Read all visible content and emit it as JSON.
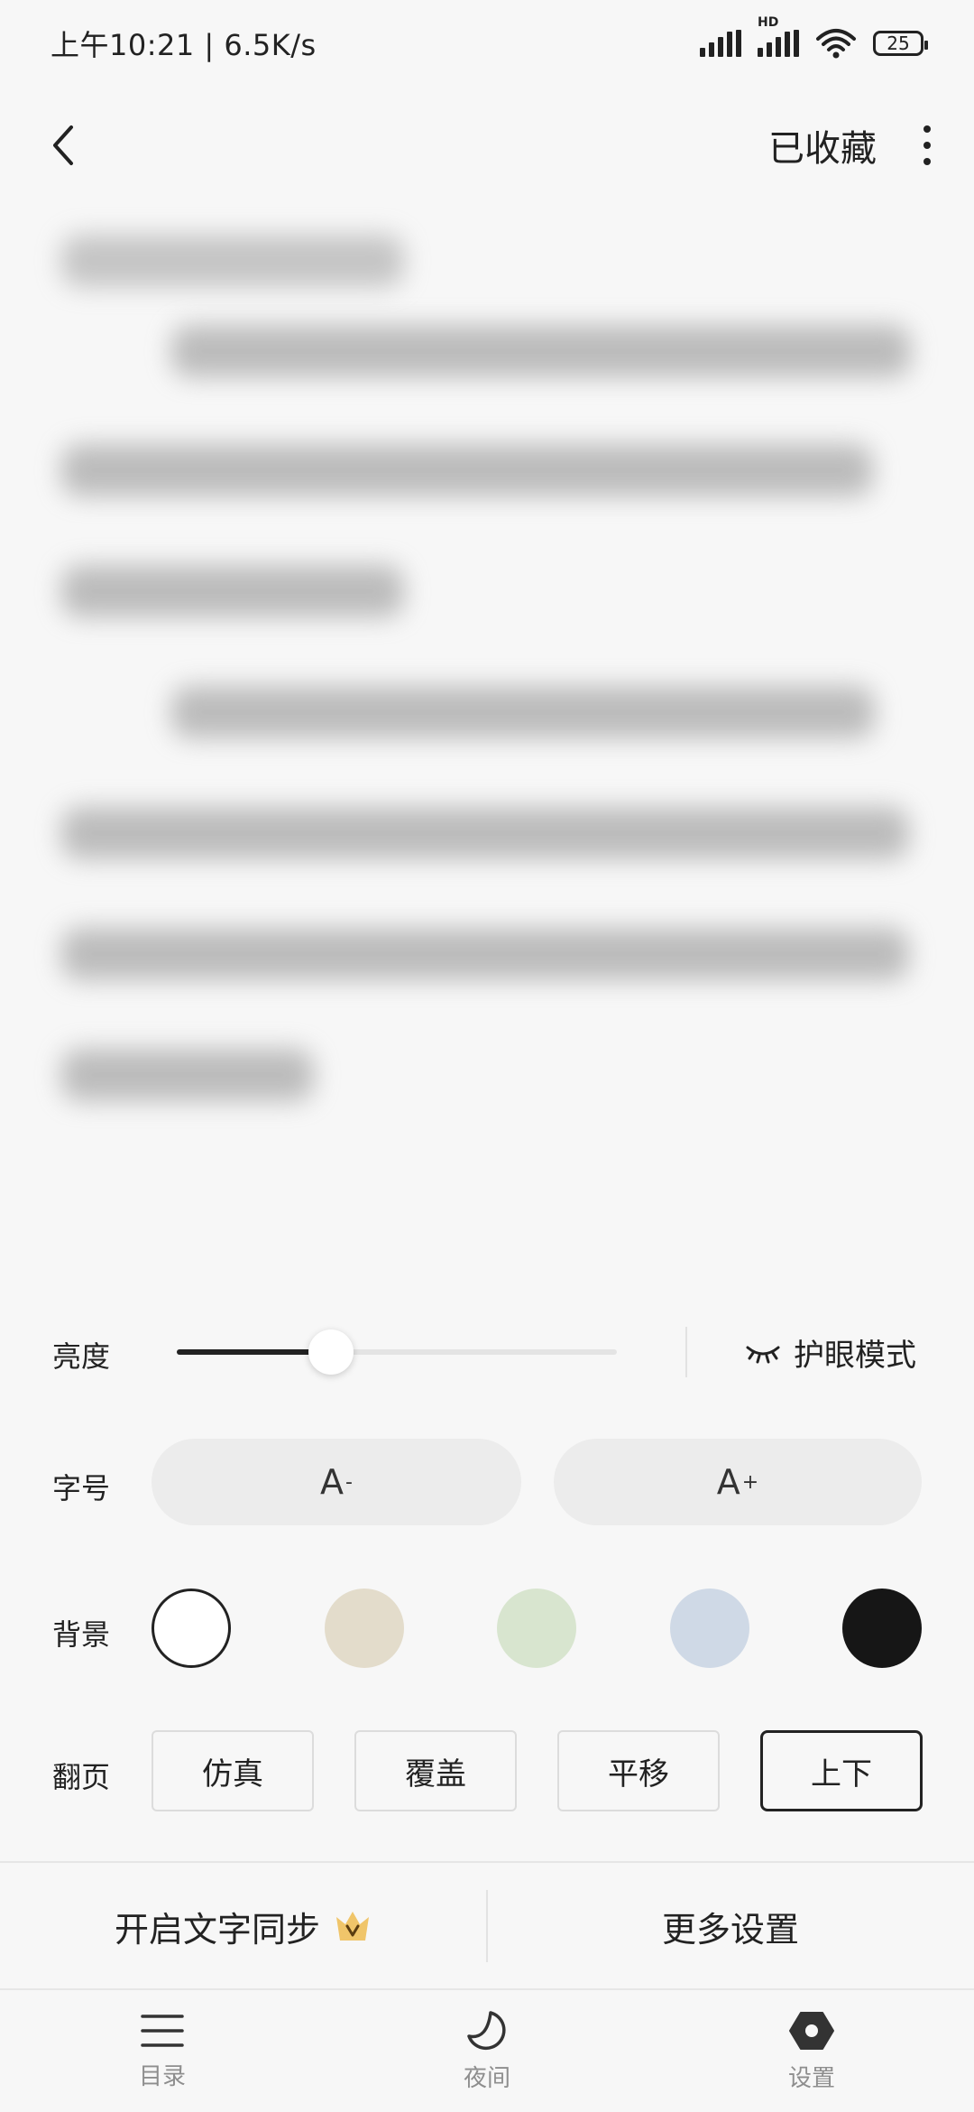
{
  "status_bar": {
    "time_speed": "上午10:21 | 6.5K/s",
    "hd_label": "HD",
    "battery": "25"
  },
  "top_bar": {
    "collected_label": "已收藏"
  },
  "settings": {
    "brightness": {
      "label": "亮度",
      "value_fraction": 0.35
    },
    "eye_mode_label": "护眼模式",
    "font_size": {
      "label": "字号",
      "decrease_label": "A",
      "decrease_sup": "-",
      "increase_label": "A",
      "increase_sup": "+"
    },
    "background": {
      "label": "背景",
      "colors": [
        "#ffffff",
        "#e3dccb",
        "#d8e5cf",
        "#cfd9e6",
        "#161616"
      ],
      "selected_index": 0
    },
    "page_turn": {
      "label": "翻页",
      "options": [
        "仿真",
        "覆盖",
        "平移",
        "上下"
      ],
      "selected_index": 3
    }
  },
  "actions": {
    "text_sync_label": "开启文字同步",
    "more_settings_label": "更多设置"
  },
  "bottom_nav": {
    "items": [
      {
        "label": "目录",
        "icon": "menu-icon"
      },
      {
        "label": "夜间",
        "icon": "moon-icon"
      },
      {
        "label": "设置",
        "icon": "settings-hexagon-icon"
      }
    ]
  },
  "colors": {
    "accent": "#222222",
    "crown": "#f0c56a"
  }
}
